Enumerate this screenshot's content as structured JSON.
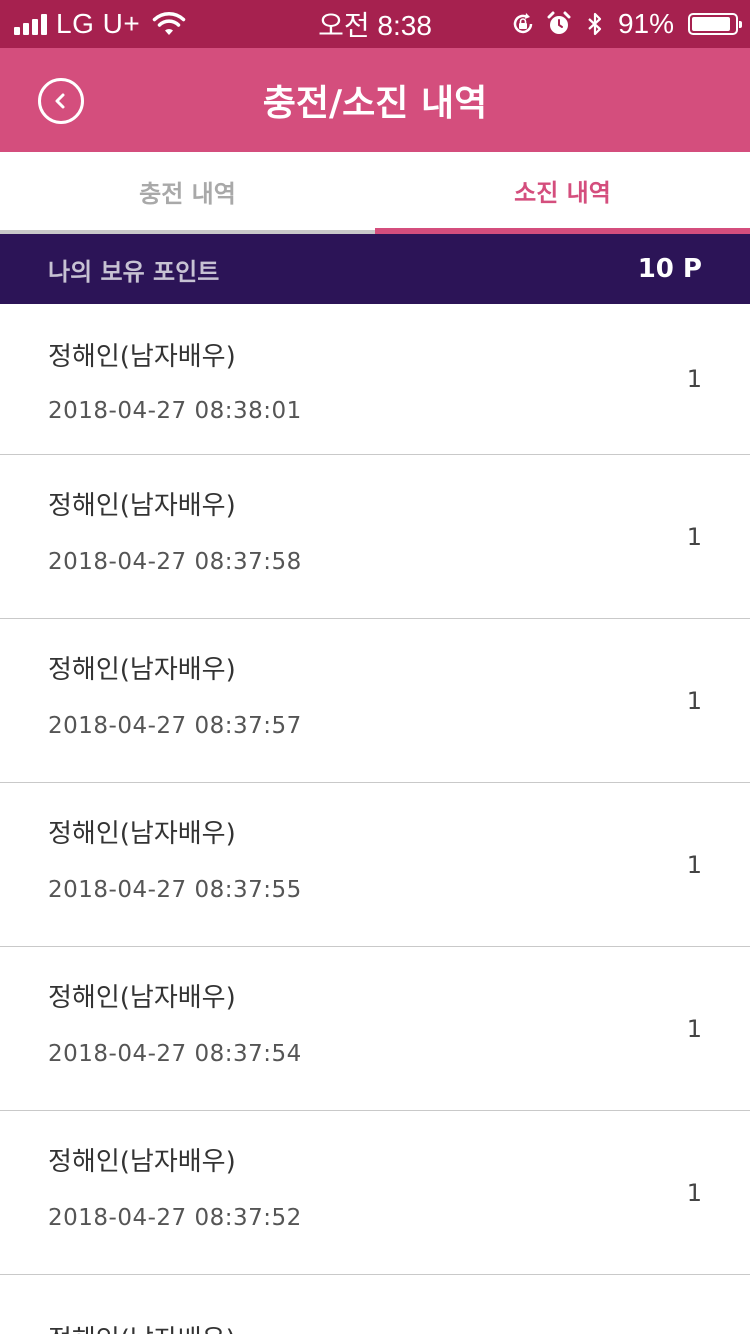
{
  "status_bar": {
    "carrier": "LG U+",
    "time": "오전 8:38",
    "battery_percent": "91%",
    "battery_level": 0.91
  },
  "nav": {
    "title": "충전/소진 내역",
    "back_icon": "chevron-left-icon"
  },
  "tabs": [
    {
      "label": "충전 내역",
      "active": false
    },
    {
      "label": "소진 내역",
      "active": true
    }
  ],
  "points": {
    "label": "나의 보유 포인트",
    "value": "10 P"
  },
  "history": [
    {
      "name": "정해인(남자배우)",
      "datetime": "2018-04-27 08:38:01",
      "amount": "1"
    },
    {
      "name": "정해인(남자배우)",
      "datetime": "2018-04-27 08:37:58",
      "amount": "1"
    },
    {
      "name": "정해인(남자배우)",
      "datetime": "2018-04-27 08:37:57",
      "amount": "1"
    },
    {
      "name": "정해인(남자배우)",
      "datetime": "2018-04-27 08:37:55",
      "amount": "1"
    },
    {
      "name": "정해인(남자배우)",
      "datetime": "2018-04-27 08:37:54",
      "amount": "1"
    },
    {
      "name": "정해인(남자배우)",
      "datetime": "2018-04-27 08:37:52",
      "amount": "1"
    },
    {
      "name": "정해인(남자배우)",
      "datetime": "",
      "amount": ""
    }
  ],
  "colors": {
    "status_bar": "#a6214f",
    "nav_bar": "#d44e7d",
    "accent": "#d44e7d",
    "points_bar": "#2c1457",
    "inactive_tab": "#a9a9a9"
  }
}
